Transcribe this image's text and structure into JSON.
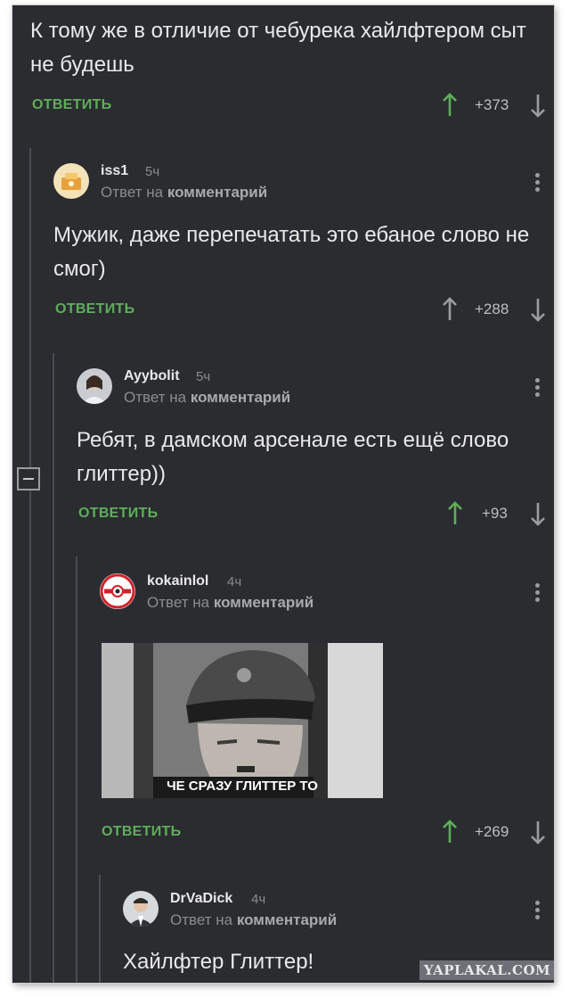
{
  "top_comment": {
    "text": "К тому же в отличие от чебурека хайлфтером сыт не будешь",
    "reply_label": "ОТВЕТИТЬ",
    "score": "+373"
  },
  "comments": [
    {
      "username": "iss1",
      "time": "5ч",
      "reply_to_prefix": "Ответ на",
      "reply_to_link": "комментарий",
      "text": "Мужик, даже перепечатать это ебаное слово не смог)",
      "reply_label": "ОТВЕТИТЬ",
      "score": "+288"
    },
    {
      "username": "Ayybolit",
      "time": "5ч",
      "reply_to_prefix": "Ответ на",
      "reply_to_link": "комментарий",
      "text": "Ребят, в дамском арсенале есть ещё слово глиттер))",
      "reply_label": "ОТВЕТИТЬ",
      "score": "+93"
    },
    {
      "username": "kokainlol",
      "time": "4ч",
      "reply_to_prefix": "Ответ на",
      "reply_to_link": "комментарий",
      "meme_caption": "ЧЕ СРАЗУ ГЛИТТЕР ТО",
      "reply_label": "ОТВЕТИТЬ",
      "score": "+269"
    },
    {
      "username": "DrVaDick",
      "time": "4ч",
      "reply_to_prefix": "Ответ на",
      "reply_to_link": "комментарий",
      "text": "Хайлфтер Глиттер!"
    }
  ],
  "watermark": "YAPLAKAL.COM",
  "colors": {
    "background": "#2a2c30",
    "reply": "#5fae5a",
    "upvote_active": "#5fae5a",
    "text": "#e9e9e9"
  }
}
